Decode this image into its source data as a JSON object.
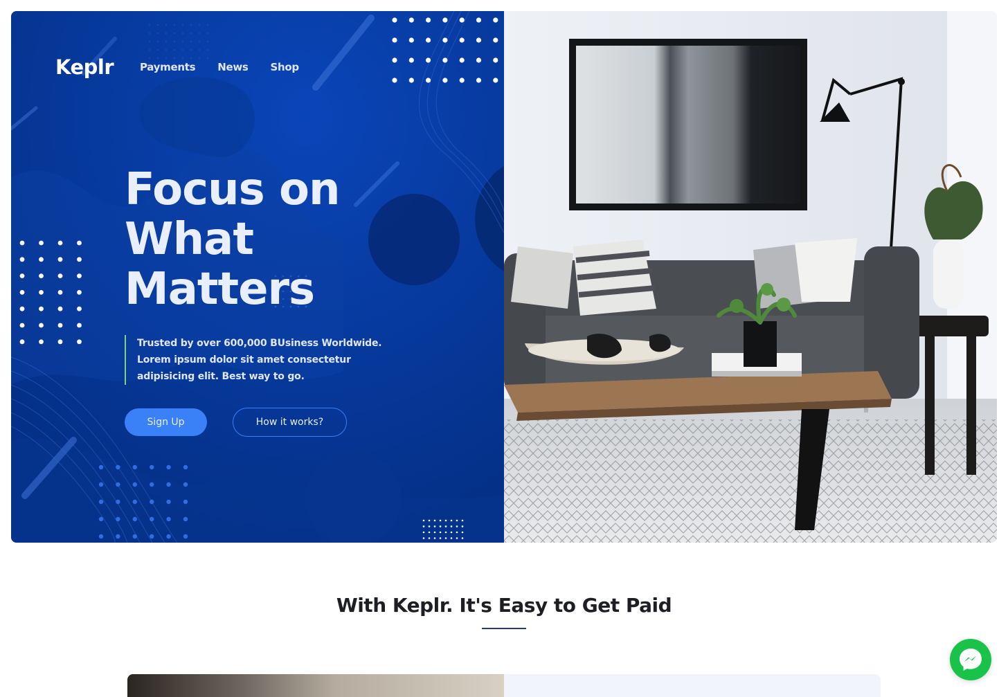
{
  "brand": {
    "name": "Keplr"
  },
  "nav": {
    "items": [
      {
        "label": "Payments"
      },
      {
        "label": "News"
      },
      {
        "label": "Shop"
      }
    ]
  },
  "hero": {
    "headline_lines": [
      "Focus on",
      "What",
      "Matters"
    ],
    "lede": "Trusted by over 600,000 BUsiness Worldwide. Lorem ipsum dolor sit amet consectetur adipisicing elit. Best way to go.",
    "primary_cta": "Sign Up",
    "secondary_cta": "How it works?"
  },
  "section": {
    "title": "With Keplr. It's Easy to Get Paid"
  },
  "widgets": {
    "messenger_icon": "messenger-icon"
  },
  "colors": {
    "hero_bg": "#043087",
    "primary": "#3a80f6",
    "accent_line": "#7fd37a",
    "messenger": "#19c34a"
  }
}
